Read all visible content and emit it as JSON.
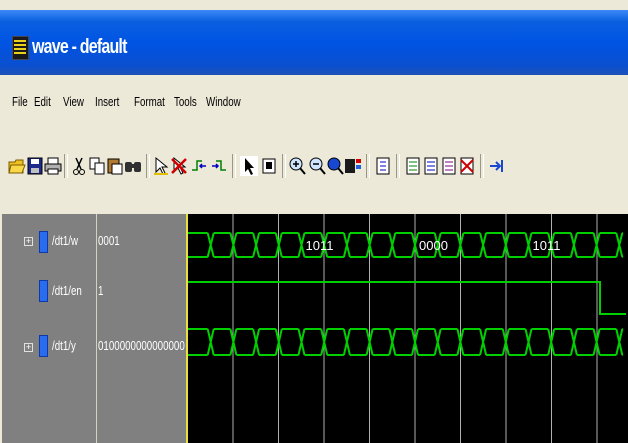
{
  "window": {
    "title": "wave - default"
  },
  "menu": [
    "File",
    "Edit",
    "View",
    "Insert",
    "Format",
    "Tools",
    "Window"
  ],
  "toolbar": {
    "groups": [
      [
        "open-icon",
        "save-icon",
        "print-icon"
      ],
      [
        "cut-icon",
        "copy-icon",
        "paste-icon",
        "find-icon"
      ],
      [
        "insert-cursor-icon",
        "delete-cursor-icon",
        "previous-edge-icon",
        "next-edge-icon"
      ],
      [
        "select-mode-icon",
        "zoom-mode-icon"
      ],
      [
        "zoom-in-icon",
        "zoom-out-icon",
        "zoom-full-icon",
        "zoom-cursor-icon"
      ],
      [
        "find-edge-icon"
      ],
      [
        "add-wave-icon",
        "add-list-icon",
        "add-log-icon",
        "delete-wave-icon"
      ],
      [
        "step-icon"
      ]
    ]
  },
  "signals": [
    {
      "name": "/dt1/w",
      "value": "0001",
      "bus": true,
      "expandable": true
    },
    {
      "name": "/dt1/en",
      "value": "1",
      "bus": false,
      "expandable": false
    },
    {
      "name": "/dt1/y",
      "value": "0100000000000000",
      "bus": true,
      "expandable": true
    }
  ],
  "waveform_labels": {
    "w": [
      {
        "text": "1011",
        "t": 5
      },
      {
        "text": "0000",
        "t": 10
      },
      {
        "text": "1011",
        "t": 15
      }
    ]
  },
  "colors": {
    "wave": "#00d000",
    "cursor": "#e8e040",
    "grid": "#b0b0b0",
    "title_bar": "#0054e3"
  }
}
